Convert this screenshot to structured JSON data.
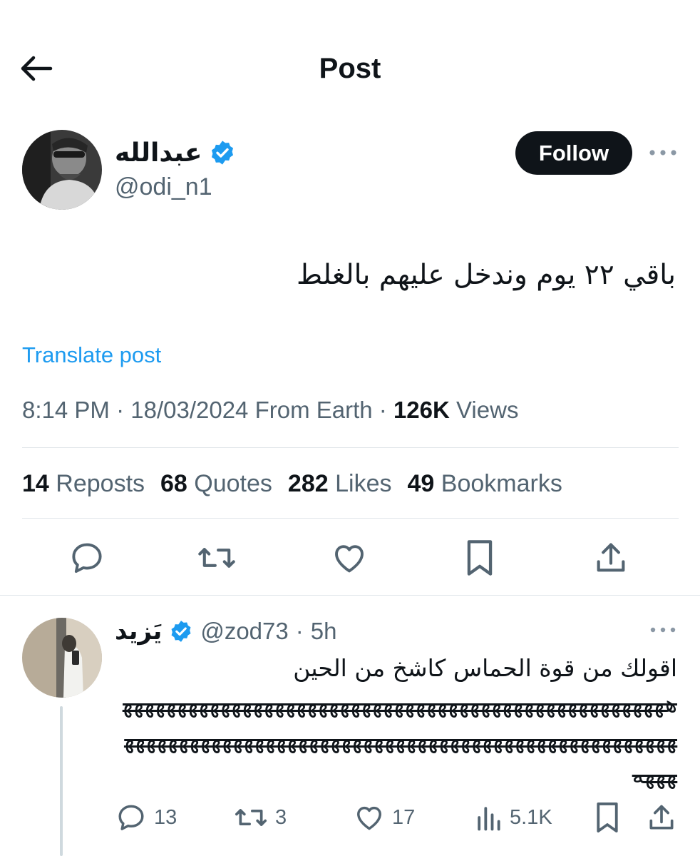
{
  "header": {
    "title": "Post",
    "back_icon": "arrow-left-icon"
  },
  "post": {
    "author_name": "عبدالله",
    "author_handle": "@odi_n1",
    "verified_color": "#1d9bf0",
    "follow_label": "Follow",
    "text": "باقي ٢٢ يوم وندخل عليهم بالغلط",
    "translate_label": "Translate post",
    "time": "8:14 PM",
    "date": "18/03/2024",
    "source": "From Earth",
    "views_count": "126K",
    "views_label": "Views",
    "stats": [
      {
        "count": "14",
        "label": "Reposts"
      },
      {
        "count": "68",
        "label": "Quotes"
      },
      {
        "count": "282",
        "label": "Likes"
      },
      {
        "count": "49",
        "label": "Bookmarks"
      }
    ],
    "actions": [
      "reply-icon",
      "repost-icon",
      "like-icon",
      "bookmark-icon",
      "share-icon"
    ]
  },
  "reply": {
    "author_name": "يَزيد",
    "author_handle": "@zod73",
    "time": "5h",
    "text_line": "اقولك من قوة الحماس كاشخ من الحين",
    "strike_text": "هههههههههههههههههههههههههههههههههههههههههههههههههههههههههههههههههههههههههههههههههههههههههههههههههههههههههه",
    "counts": {
      "replies": "13",
      "reposts": "3",
      "likes": "17",
      "views": "5.1K"
    }
  },
  "colors": {
    "accent": "#1d9bf0",
    "text": "#0f1419",
    "secondary": "#536471",
    "divider": "#e1e6ea"
  }
}
